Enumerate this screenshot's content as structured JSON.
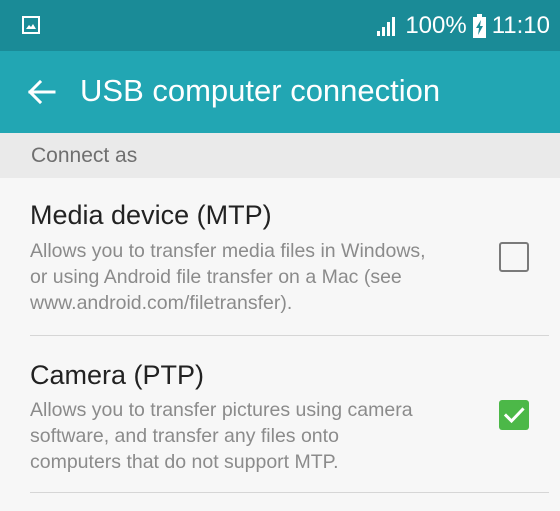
{
  "status_bar": {
    "signal_icon": "signal-bars-icon",
    "battery_percent": "100%",
    "battery_icon": "battery-charging-icon",
    "time": "11:10",
    "notification_icon": "gallery-icon"
  },
  "app_bar": {
    "back_icon": "back-arrow-icon",
    "title": "USB computer connection"
  },
  "section": {
    "header": "Connect as"
  },
  "options": [
    {
      "title": "Media device (MTP)",
      "description_lines": [
        "Allows you to transfer media files in Windows,",
        "or using Android file transfer on a Mac (see",
        "www.android.com/filetransfer)."
      ],
      "checked": false
    },
    {
      "title": "Camera (PTP)",
      "description_lines": [
        "Allows you to transfer pictures using camera",
        "software, and transfer any files onto",
        "computers that do not support MTP."
      ],
      "checked": true
    }
  ],
  "colors": {
    "status_bar": "#1a8b97",
    "app_bar": "#22a6b3",
    "checkbox_checked": "#4cb848"
  }
}
